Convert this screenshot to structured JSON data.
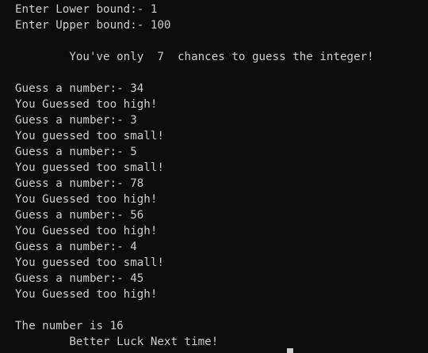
{
  "console": {
    "lines": [
      "Enter Lower bound:- 1",
      "Enter Upper bound:- 100",
      "",
      "        You've only  7  chances to guess the integer!",
      "",
      "Guess a number:- 34",
      "You Guessed too high!",
      "Guess a number:- 3",
      "You guessed too small!",
      "Guess a number:- 5",
      "You guessed too small!",
      "Guess a number:- 78",
      "You Guessed too high!",
      "Guess a number:- 56",
      "You Guessed too high!",
      "Guess a number:- 4",
      "You guessed too small!",
      "Guess a number:- 45",
      "You Guessed too high!",
      "",
      "The number is 16",
      "        Better Luck Next time!"
    ]
  },
  "colors": {
    "background": "#0c0c0c",
    "text": "#cccccc"
  }
}
